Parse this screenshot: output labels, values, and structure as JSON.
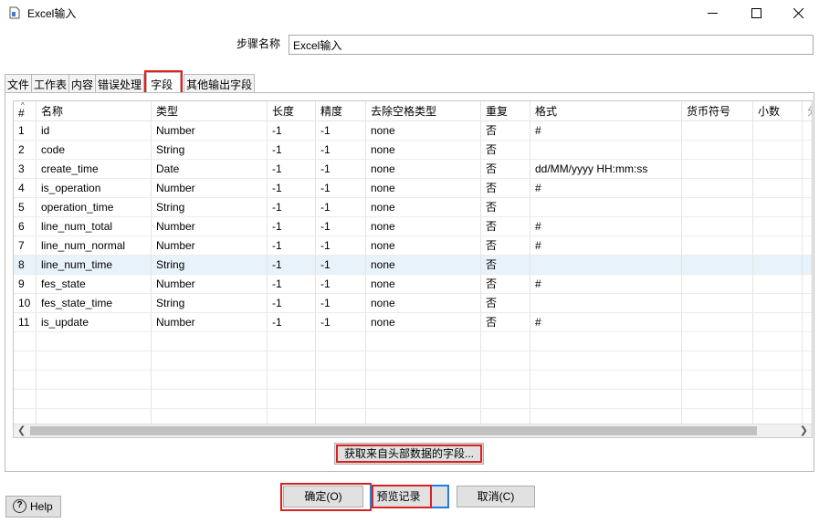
{
  "window": {
    "title": "Excel输入",
    "app_icon": "document-icon",
    "min_icon": "minimize-icon",
    "max_icon": "maximize-icon",
    "close_icon": "close-icon"
  },
  "step": {
    "label": "步骤名称",
    "value": "Excel输入"
  },
  "tabs": [
    {
      "label": "文件"
    },
    {
      "label": "工作表"
    },
    {
      "label": "内容"
    },
    {
      "label": "错误处理"
    },
    {
      "label": "字段"
    },
    {
      "label": "其他输出字段"
    }
  ],
  "table": {
    "headers": [
      "#",
      "名称",
      "类型",
      "长度",
      "精度",
      "去除空格类型",
      "重复",
      "格式",
      "货币符号",
      "小数",
      "分"
    ],
    "sort_glyph": "^",
    "rows": [
      [
        "1",
        "id",
        "Number",
        "-1",
        "-1",
        "none",
        "否",
        "#",
        "",
        ""
      ],
      [
        "2",
        "code",
        "String",
        "-1",
        "-1",
        "none",
        "否",
        "",
        "",
        ""
      ],
      [
        "3",
        "create_time",
        "Date",
        "-1",
        "-1",
        "none",
        "否",
        "dd/MM/yyyy HH:mm:ss",
        "",
        ""
      ],
      [
        "4",
        "is_operation",
        "Number",
        "-1",
        "-1",
        "none",
        "否",
        "#",
        "",
        ""
      ],
      [
        "5",
        "operation_time",
        "String",
        "-1",
        "-1",
        "none",
        "否",
        "",
        "",
        ""
      ],
      [
        "6",
        "line_num_total",
        "Number",
        "-1",
        "-1",
        "none",
        "否",
        "#",
        "",
        ""
      ],
      [
        "7",
        "line_num_normal",
        "Number",
        "-1",
        "-1",
        "none",
        "否",
        "#",
        "",
        ""
      ],
      [
        "8",
        "line_num_time",
        "String",
        "-1",
        "-1",
        "none",
        "否",
        "",
        "",
        ""
      ],
      [
        "9",
        "fes_state",
        "Number",
        "-1",
        "-1",
        "none",
        "否",
        "#",
        "",
        ""
      ],
      [
        "10",
        "fes_state_time",
        "String",
        "-1",
        "-1",
        "none",
        "否",
        "",
        "",
        ""
      ],
      [
        "11",
        "is_update",
        "Number",
        "-1",
        "-1",
        "none",
        "否",
        "#",
        "",
        ""
      ]
    ],
    "selected_row": 8
  },
  "buttons": {
    "get_fields": "获取来自头部数据的字段...",
    "ok": "确定(O)",
    "preview": "预览记录",
    "cancel": "取消(C)",
    "help": "Help"
  },
  "colors": {
    "highlight_red": "#d92121",
    "focus_blue": "#1a7ee0",
    "selected_row": "#e8f2fb"
  }
}
